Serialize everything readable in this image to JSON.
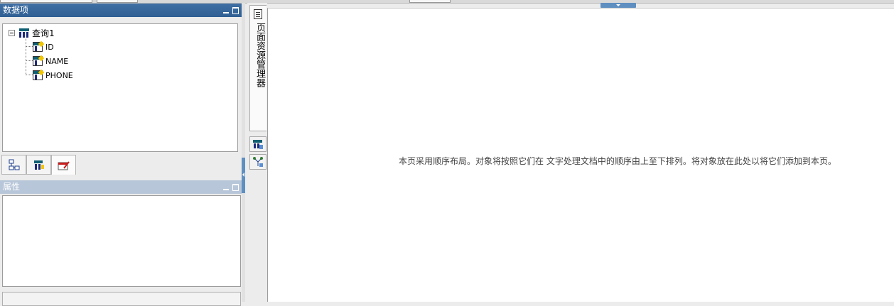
{
  "data_panel": {
    "title": "数据项",
    "tree": {
      "root_label": "查询1",
      "fields": [
        "ID",
        "NAME",
        "PHONE"
      ]
    },
    "bottom_tabs": [
      "relation-icon",
      "table-field-icon",
      "table-edit-icon"
    ]
  },
  "props_panel": {
    "title": "属性"
  },
  "side_strip": {
    "page_manager_label": "页面资源管理器"
  },
  "canvas": {
    "hint": "本页采用顺序布局。对象将按照它们在 文字处理文档中的顺序由上至下排列。将对象放在此处以将它们添加到本页。"
  },
  "colors": {
    "active_header": "#2f5f93",
    "inactive_header": "#b8c6d9",
    "accent_handle": "#5f8fc0"
  }
}
